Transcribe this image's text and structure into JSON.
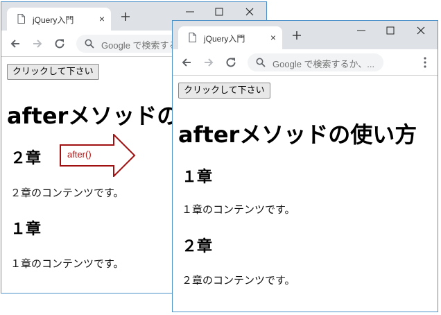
{
  "browser": {
    "tab_title": "jQuery入門",
    "tab_close": "×",
    "omnibox_placeholder": "Google で検索するか、..."
  },
  "back_window": {
    "button_label": "クリックして下さい",
    "heading": "afterメソッドの使い方",
    "sections": [
      {
        "title": "２章",
        "text": "２章のコンテンツです。"
      },
      {
        "title": "１章",
        "text": "１章のコンテンツです。"
      }
    ]
  },
  "front_window": {
    "button_label": "クリックして下さい",
    "heading": "afterメソッドの使い方",
    "sections": [
      {
        "title": "１章",
        "text": "１章のコンテンツです。"
      },
      {
        "title": "２章",
        "text": "２章のコンテンツです。"
      }
    ]
  },
  "annotation": {
    "arrow_label": "after()",
    "arrow_color": "#a01010"
  },
  "colors": {
    "window_border": "#4a90c8",
    "titlebar": "#dee1e6",
    "omnibox": "#f1f3f4"
  }
}
